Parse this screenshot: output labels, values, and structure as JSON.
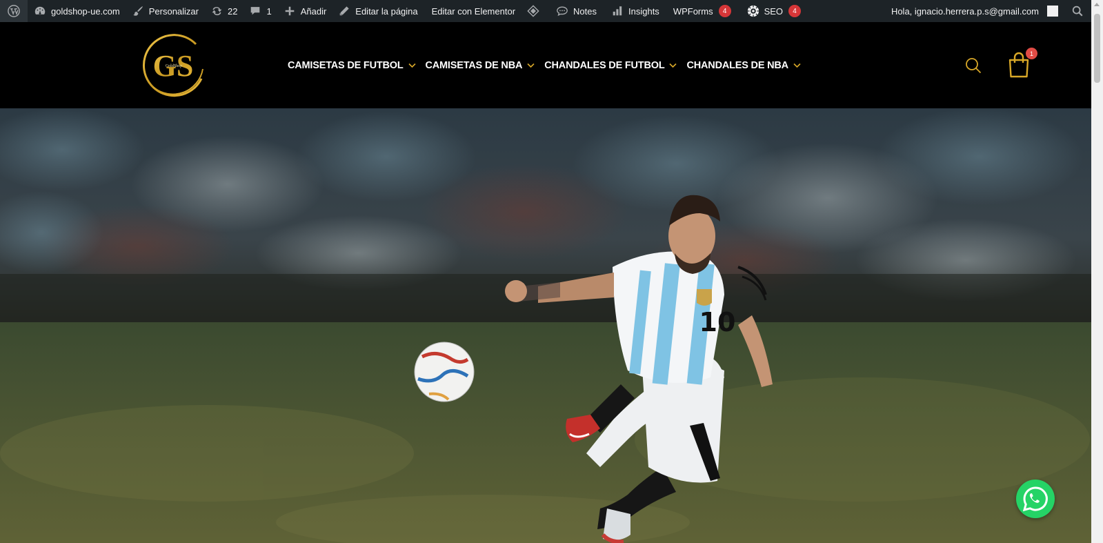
{
  "admin_bar": {
    "site_name": "goldshop-ue.com",
    "customize": "Personalizar",
    "updates_count": "22",
    "comments_count": "1",
    "add_new": "Añadir",
    "edit_page": "Editar la página",
    "edit_elementor": "Editar con Elementor",
    "notes": "Notes",
    "insights": "Insights",
    "wpforms": "WPForms",
    "wpforms_badge": "4",
    "seo": "SEO",
    "seo_badge": "4",
    "greeting": "Hola, ignacio.herrera.p.s@gmail.com"
  },
  "header": {
    "logo_text": "GS",
    "logo_subtext": "GoldShop",
    "nav": [
      {
        "label": "CAMISETAS DE FUTBOL"
      },
      {
        "label": "CAMISETAS DE NBA"
      },
      {
        "label": "CHANDALES DE FUTBOL"
      },
      {
        "label": "CHANDALES DE NBA"
      }
    ],
    "cart_count": "1"
  },
  "hero": {
    "jersey_number": "10"
  },
  "colors": {
    "gold": "#d9a828",
    "admin_bg": "#1d2327",
    "badge": "#d63638",
    "whatsapp": "#25d366"
  },
  "icons": [
    "wordpress-icon",
    "dashboard-icon",
    "brush-icon",
    "updates-icon",
    "comment-icon",
    "plus-icon",
    "pencil-icon",
    "elementor-icon",
    "notes-icon",
    "insights-icon",
    "seo-icon",
    "search-icon",
    "cart-icon",
    "whatsapp-icon",
    "chevron-down-icon"
  ]
}
